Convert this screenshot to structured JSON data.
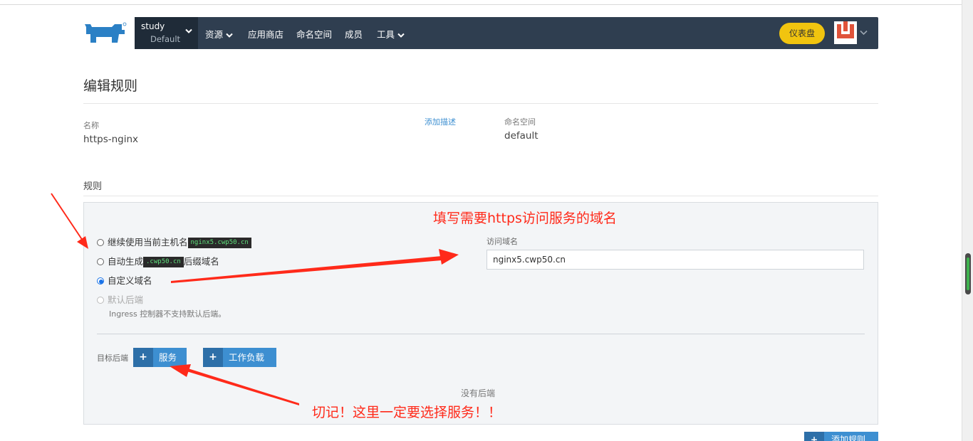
{
  "nav": {
    "project_name": "study",
    "project_sub": "Default",
    "items": [
      {
        "label": "资源",
        "dropdown": true
      },
      {
        "label": "应用商店",
        "dropdown": false
      },
      {
        "label": "命名空间",
        "dropdown": false
      },
      {
        "label": "成员",
        "dropdown": false
      },
      {
        "label": "工具",
        "dropdown": true
      }
    ],
    "dashboard_label": "仪表盘"
  },
  "page": {
    "title": "编辑规则",
    "name_label": "名称",
    "name_value": "https-nginx",
    "add_desc_link": "添加描述",
    "namespace_label": "命名空间",
    "namespace_value": "default"
  },
  "rules": {
    "section_title": "规则",
    "options": [
      {
        "label": "继续使用当前主机名",
        "tag": "nginx5.cwp50.cn",
        "selected": false,
        "disabled": false
      },
      {
        "label": "自动生成",
        "tag": ".cwp50.cn",
        "suffix": "后缀域名",
        "selected": false,
        "disabled": false
      },
      {
        "label": "自定义域名",
        "selected": true,
        "disabled": false
      },
      {
        "label": "默认后端",
        "selected": false,
        "disabled": true
      }
    ],
    "default_backend_hint": "Ingress 控制器不支持默认后端。",
    "domain_label": "访问域名",
    "domain_value": "nginx5.cwp50.cn",
    "target_label": "目标后端",
    "service_btn": "服务",
    "workload_btn": "工作负载",
    "empty_text": "没有后端",
    "add_rule_btn": "添加规则"
  },
  "annotations": {
    "top": "填写需要https访问服务的域名",
    "bottom": "切记！这里一定要选择服务！！"
  },
  "colors": {
    "nav_bg": "#2f3e50",
    "accent": "#3d8fd1",
    "dashboard": "#f1c40f",
    "annotation": "#ff2a1a"
  }
}
